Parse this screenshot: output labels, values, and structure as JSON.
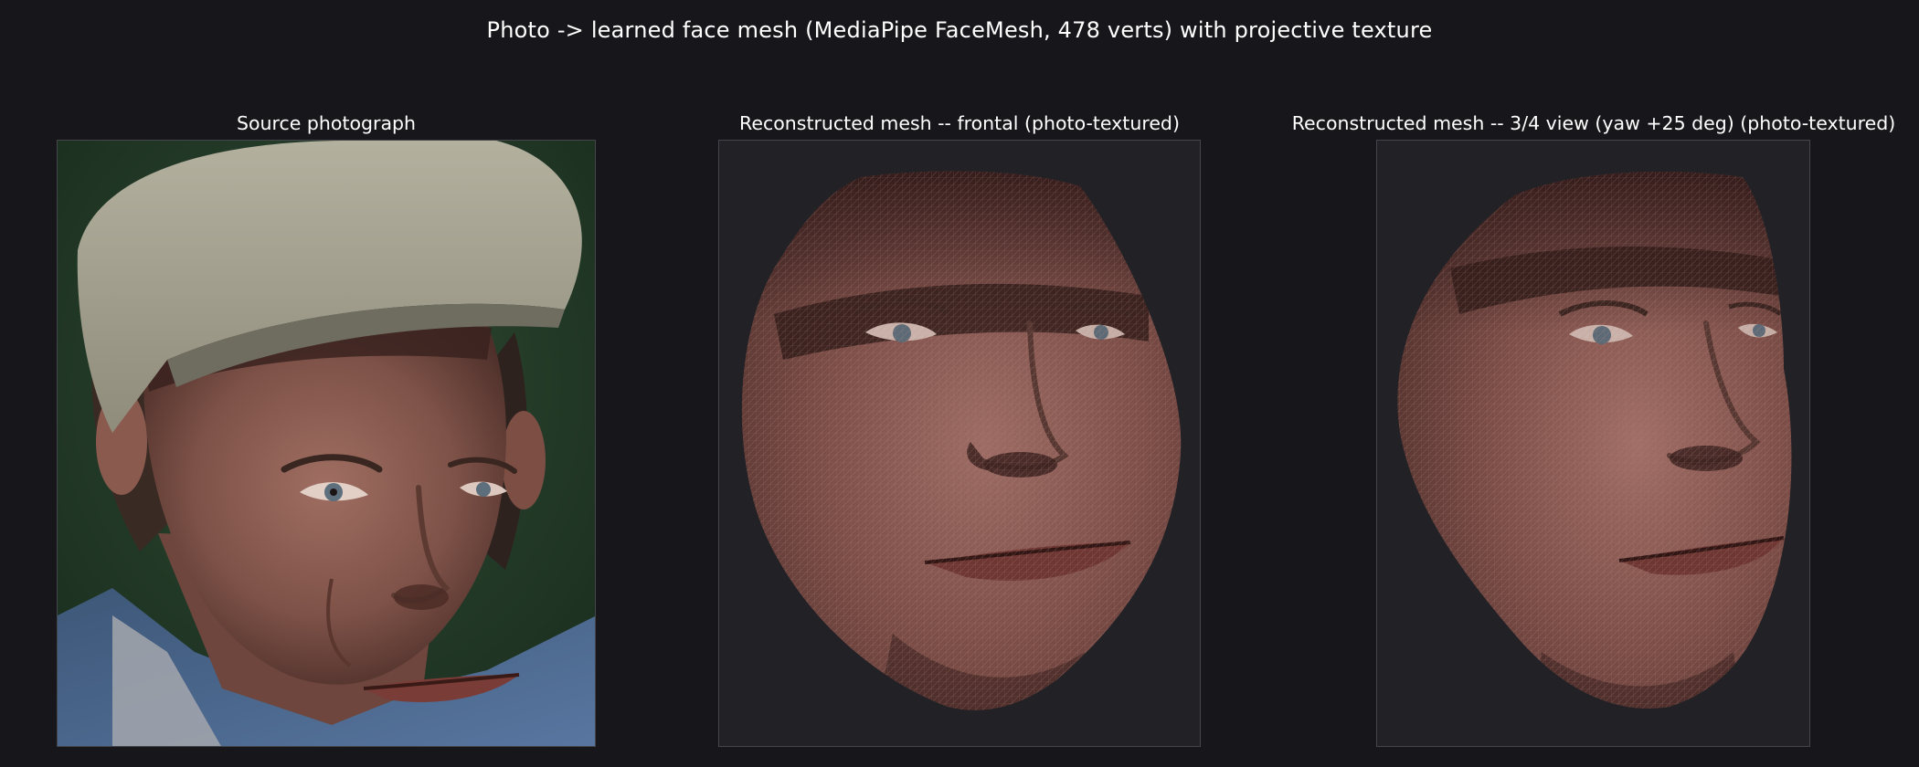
{
  "suptitle": "Photo -> learned face mesh (MediaPipe FaceMesh, 478 verts) with projective texture",
  "panels": [
    {
      "title": "Source photograph"
    },
    {
      "title": "Reconstructed mesh -- frontal (photo-textured)"
    },
    {
      "title": "Reconstructed mesh -- 3/4 view (yaw +25 deg) (photo-textured)"
    }
  ],
  "colors": {
    "figure_background": "#17171b",
    "axes_background": "#212126",
    "axes_edge": "#45454c",
    "text": "#ffffff"
  }
}
